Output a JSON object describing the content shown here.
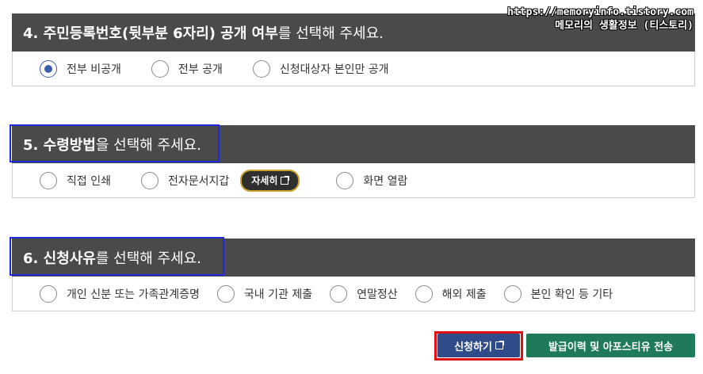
{
  "watermark": {
    "line1": "https://memoryinfo.tistory.com",
    "line2": "메모리의 생활정보 (티스토리)"
  },
  "section4": {
    "title_bold": "4. 주민등록번호(뒷부분 6자리) 공개 여부",
    "title_rest": "를 선택해 주세요.",
    "options": [
      "전부 비공개",
      "전부 공개",
      "신청대상자 본인만 공개"
    ],
    "selected": 0
  },
  "section5": {
    "title_bold": "5. 수령방법",
    "title_rest": "을 선택해 주세요.",
    "options": [
      "직접 인쇄",
      "전자문서지갑",
      "화면 열람"
    ],
    "detail_button": "자세히"
  },
  "section6": {
    "title_bold": "6. 신청사유",
    "title_rest": "를 선택해 주세요.",
    "options": [
      "개인 신분 또는 가족관계증명",
      "국내 기관 제출",
      "연말정산",
      "해외 제출",
      "본인 확인 등 기타"
    ]
  },
  "buttons": {
    "apply": "신청하기",
    "send": "발급이력 및 아포스티유 전송"
  },
  "colors": {
    "header_bg": "#4a4a4a",
    "radio_selected": "#3a5fa8",
    "apply_bg": "#2f4b8a",
    "send_bg": "#1f7a5a",
    "highlight_blue": "#1f2bd8",
    "highlight_red": "#e01010",
    "detail_border": "#c9a227"
  }
}
